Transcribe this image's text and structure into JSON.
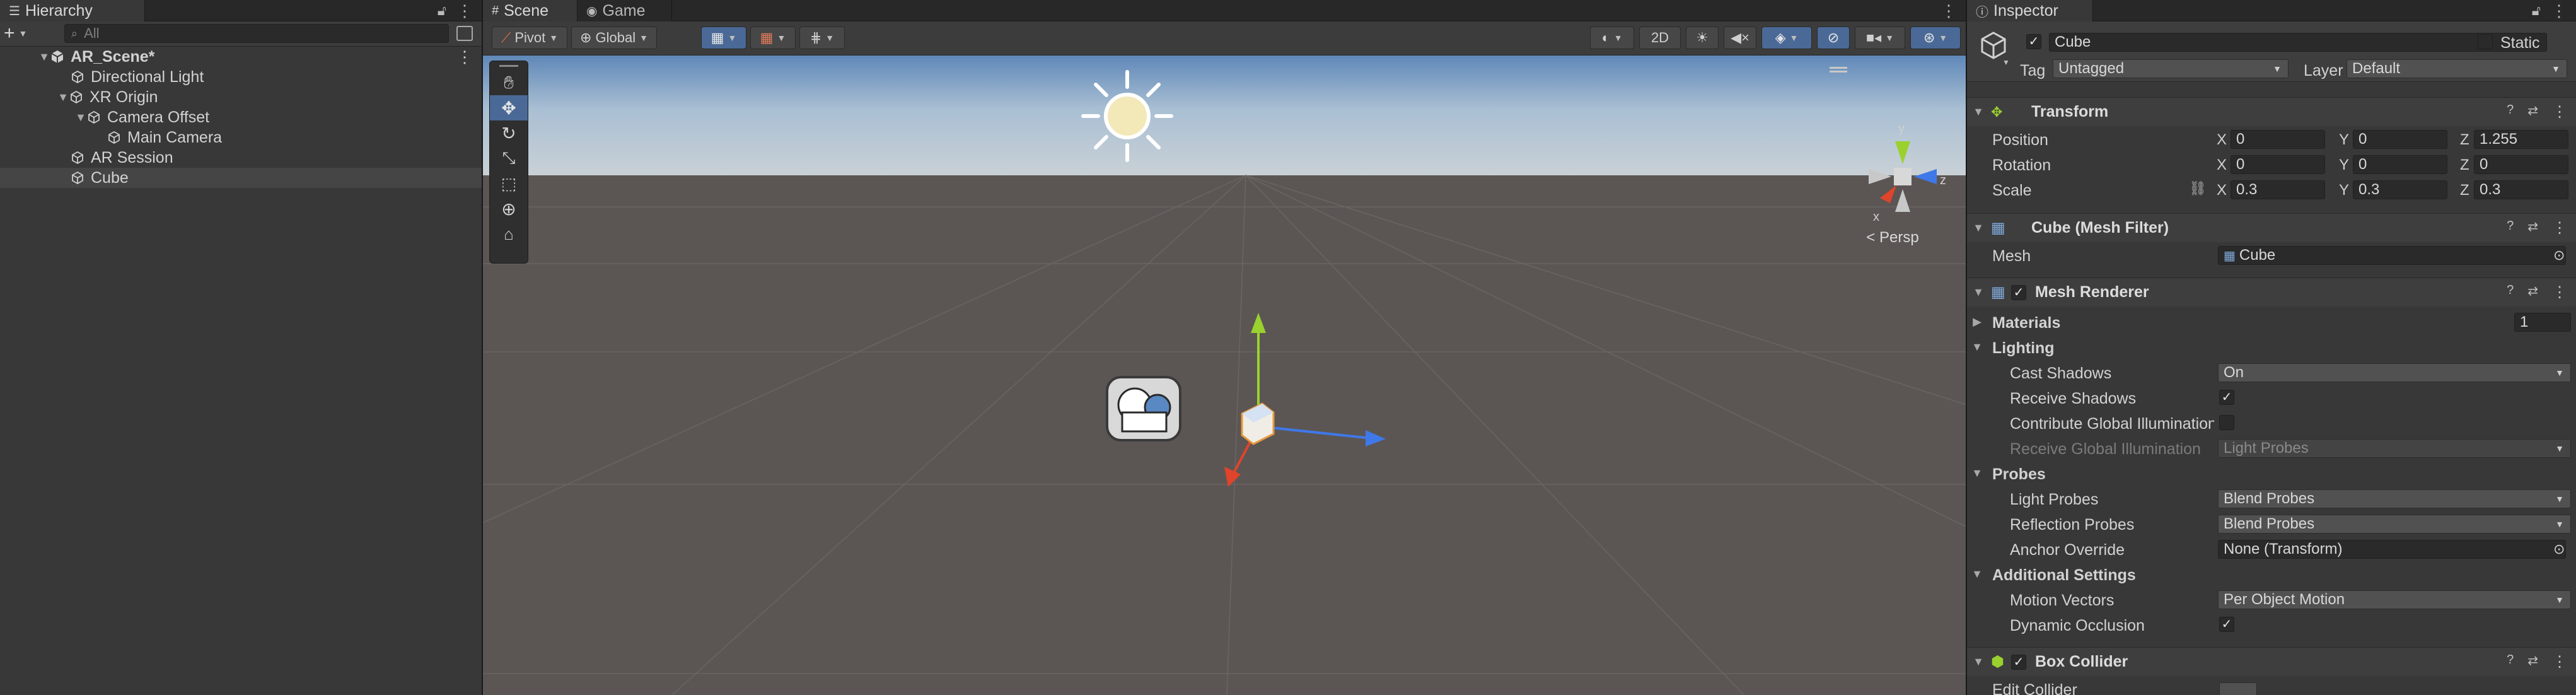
{
  "hierarchy": {
    "tab_label": "Hierarchy",
    "add_label": "+",
    "search_placeholder": "All",
    "items": [
      {
        "label": "AR_Scene*",
        "depth": 0
      },
      {
        "label": "Directional Light",
        "depth": 1
      },
      {
        "label": "XR Origin",
        "depth": 1
      },
      {
        "label": "Camera Offset",
        "depth": 2
      },
      {
        "label": "Main Camera",
        "depth": 3
      },
      {
        "label": "AR Session",
        "depth": 1
      },
      {
        "label": "Cube",
        "depth": 1
      }
    ]
  },
  "scene": {
    "tabs": [
      "Scene",
      "Game"
    ],
    "pivot_label": "Pivot",
    "global_label": "Global",
    "mode_2d_label": "2D",
    "persp_label": "< Persp",
    "gizmo_axes": {
      "x": "x",
      "y": "y",
      "z": "z"
    }
  },
  "inspector": {
    "tab_label": "Inspector",
    "object_name": "Cube",
    "static_label": "Static",
    "tag_label": "Tag",
    "tag_value": "Untagged",
    "layer_label": "Layer",
    "layer_value": "Default",
    "transform": {
      "title": "Transform",
      "position_label": "Position",
      "rotation_label": "Rotation",
      "scale_label": "Scale",
      "axis_x": "X",
      "axis_y": "Y",
      "axis_z": "Z",
      "position": [
        "0",
        "0",
        "1.255"
      ],
      "rotation": [
        "0",
        "0",
        "0"
      ],
      "scale": [
        "0.3",
        "0.3",
        "0.3"
      ]
    },
    "mesh_filter": {
      "title": "Cube (Mesh Filter)",
      "mesh_label": "Mesh",
      "mesh_value": "Cube"
    },
    "mesh_renderer": {
      "title": "Mesh Renderer",
      "materials_label": "Materials",
      "materials_count": "1",
      "lighting_label": "Lighting",
      "cast_shadows_label": "Cast Shadows",
      "cast_shadows_value": "On",
      "receive_shadows_label": "Receive Shadows",
      "contribute_gi_label": "Contribute Global Illumination",
      "receive_gi_label": "Receive Global Illumination",
      "receive_gi_value": "Light Probes",
      "probes_label": "Probes",
      "light_probes_label": "Light Probes",
      "light_probes_value": "Blend Probes",
      "reflection_probes_label": "Reflection Probes",
      "reflection_probes_value": "Blend Probes",
      "anchor_override_label": "Anchor Override",
      "anchor_override_value": "None (Transform)",
      "additional_settings_label": "Additional Settings",
      "motion_vectors_label": "Motion Vectors",
      "motion_vectors_value": "Per Object Motion",
      "dynamic_occlusion_label": "Dynamic Occlusion"
    },
    "box_collider": {
      "title": "Box Collider",
      "edit_collider_label": "Edit Collider"
    }
  },
  "colors": {
    "panel_bg": "#383838",
    "selection": "#454545",
    "accent_blue": "#4a6996",
    "scene_ground": "#5b5654",
    "sky_top": "#5f88b8",
    "axis_x": "#e0442a",
    "axis_y": "#9ad12f",
    "axis_z": "#3f78e8"
  }
}
